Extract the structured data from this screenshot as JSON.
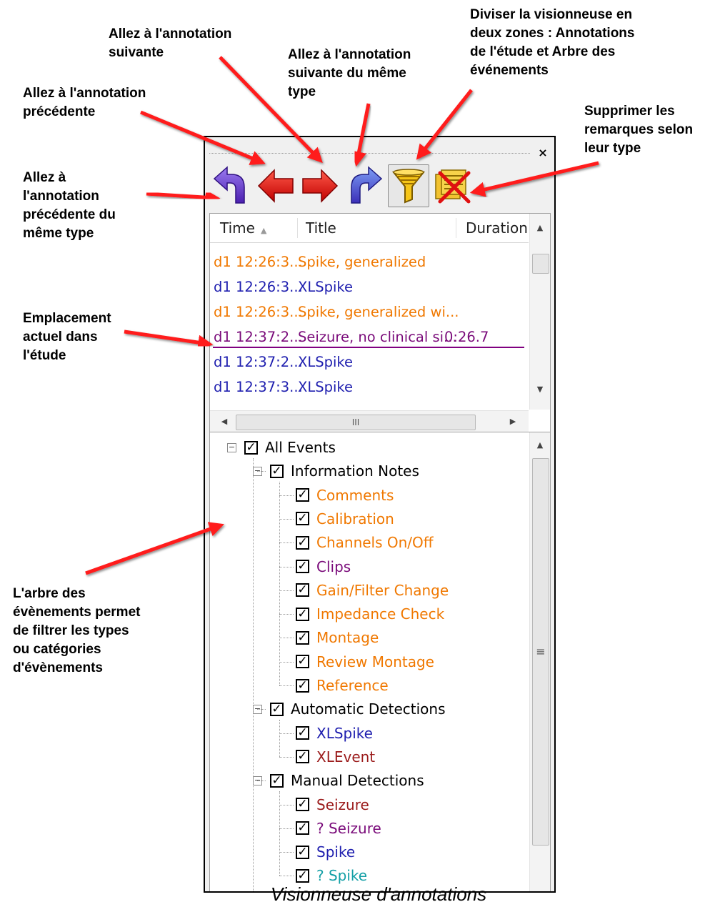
{
  "callouts": {
    "prev_same_type": [
      "Allez à",
      "l'annotation",
      "précédente du",
      "même type"
    ],
    "prev": [
      "Allez à l'annotation",
      "précédente"
    ],
    "next": [
      "Allez à l'annotation",
      "suivante"
    ],
    "next_same_type": [
      "Allez à l'annotation",
      "suivante du même",
      "type"
    ],
    "split_view": [
      "Diviser la visionneuse en",
      "deux zones : Annotations",
      "de l'étude et Arbre des",
      "événements"
    ],
    "delete_by_type": [
      "Supprimer les",
      "remarques selon",
      "leur type"
    ],
    "current_location": [
      "Emplacement",
      "actuel dans",
      "l'étude"
    ],
    "event_tree": [
      "L'arbre des",
      "évènements permet",
      "de filtrer les types",
      "ou catégories",
      "d'évènements"
    ]
  },
  "caption": "Visionneuse d'annotations",
  "panel": {
    "toolbar": [
      {
        "name": "prev-same-type-button",
        "icon": "curved-arrow-left-purple-icon"
      },
      {
        "name": "prev-annotation-button",
        "icon": "arrow-left-red-icon"
      },
      {
        "name": "next-annotation-button",
        "icon": "arrow-right-red-icon"
      },
      {
        "name": "next-same-type-button",
        "icon": "curved-arrow-right-blue-icon"
      },
      {
        "name": "split-view-button",
        "icon": "funnel-icon"
      },
      {
        "name": "delete-by-type-button",
        "icon": "delete-notes-icon"
      }
    ],
    "columns": {
      "time": "Time",
      "title": "Title",
      "duration": "Duration"
    },
    "annotations": [
      {
        "time": "d1 12:26:3...",
        "title": "Spike, generalized",
        "duration": "",
        "color": "#f07800"
      },
      {
        "time": "d1 12:26:3...",
        "title": "XLSpike",
        "duration": "",
        "color": "#1f1faf"
      },
      {
        "time": "d1 12:26:3...",
        "title": "Spike, generalized wi...",
        "duration": "",
        "color": "#f07800"
      },
      {
        "time": "d1 12:37:2...",
        "title": "Seizure, no clinical si...",
        "duration": "0:26.7",
        "color": "#7a0b7a"
      },
      {
        "time": "d1 12:37:2...",
        "title": "XLSpike",
        "duration": "",
        "color": "#1f1faf"
      },
      {
        "time": "d1 12:37:3...",
        "title": "XLSpike",
        "duration": "",
        "color": "#1f1faf"
      }
    ],
    "hscroll_grip": "III",
    "vscroll_grip": "≡",
    "tree": {
      "root": "All Events",
      "groups": [
        {
          "label": "Information Notes",
          "items": [
            {
              "label": "Comments",
              "color": "#f07800"
            },
            {
              "label": "Calibration",
              "color": "#f07800"
            },
            {
              "label": "Channels On/Off",
              "color": "#f07800"
            },
            {
              "label": "Clips",
              "color": "#7a0b7a"
            },
            {
              "label": "Gain/Filter Change",
              "color": "#f07800"
            },
            {
              "label": "Impedance Check",
              "color": "#f07800"
            },
            {
              "label": "Montage",
              "color": "#f07800"
            },
            {
              "label": "Review Montage",
              "color": "#f07800"
            },
            {
              "label": "Reference",
              "color": "#f07800"
            }
          ]
        },
        {
          "label": "Automatic Detections",
          "items": [
            {
              "label": "XLSpike",
              "color": "#1f1faf"
            },
            {
              "label": "XLEvent",
              "color": "#9b1b1b"
            }
          ]
        },
        {
          "label": "Manual Detections",
          "items": [
            {
              "label": "Seizure",
              "color": "#9b1b1b"
            },
            {
              "label": "? Seizure",
              "color": "#7a0b7a"
            },
            {
              "label": "Spike",
              "color": "#1f1faf"
            },
            {
              "label": "? Spike",
              "color": "#139fa6"
            }
          ]
        }
      ]
    }
  }
}
